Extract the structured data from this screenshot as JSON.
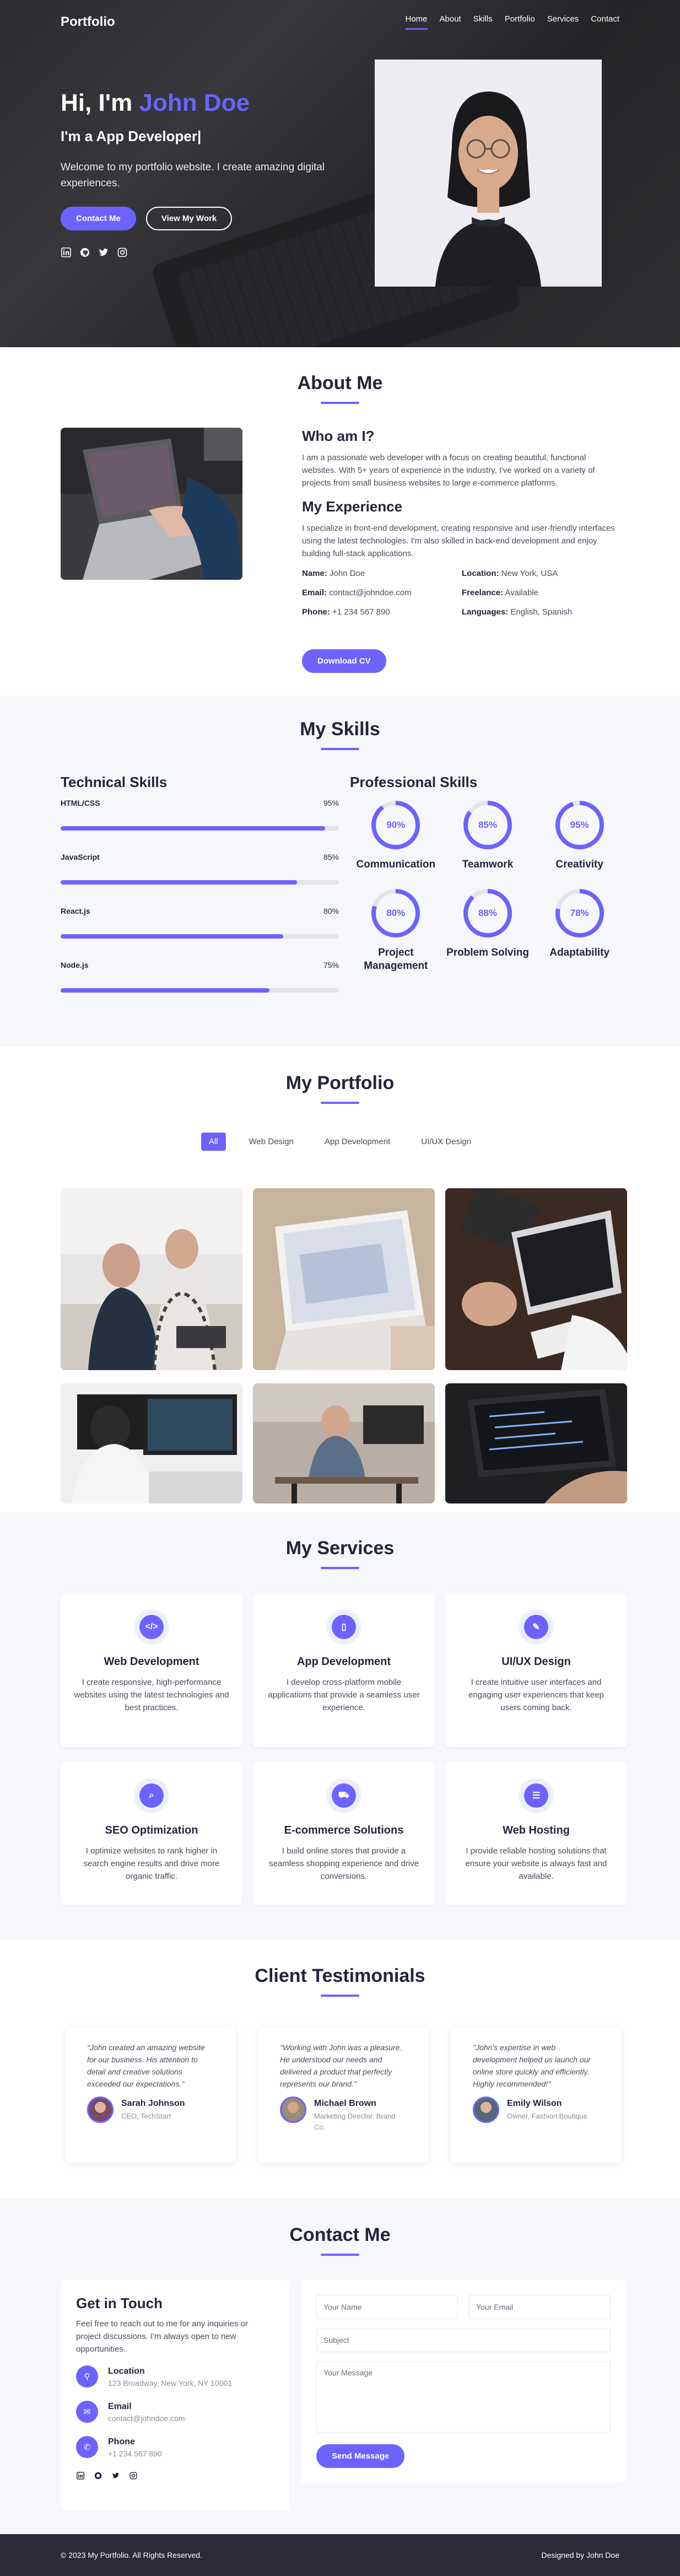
{
  "nav": {
    "logo": "Portfolio",
    "links": [
      "Home",
      "About",
      "Skills",
      "Portfolio",
      "Services",
      "Contact"
    ]
  },
  "hero": {
    "greeting": "Hi, I'm ",
    "name": "John Doe",
    "subtitle": "I'm a App Developer|",
    "description": "Welcome to my portfolio website. I create amazing digital experiences.",
    "btn_contact": "Contact Me",
    "btn_work": "View My Work",
    "socials": [
      "linkedin-icon",
      "github-icon",
      "twitter-icon",
      "instagram-icon"
    ]
  },
  "about": {
    "title": "About Me",
    "who_title": "Who am I?",
    "who_text": "I am a passionate web developer with a focus on creating beautiful, functional websites. With 5+ years of experience in the industry, I've worked on a variety of projects from small business websites to large e-commerce platforms.",
    "exp_title": "My Experience",
    "exp_text": "I specialize in front-end development, creating responsive and user-friendly interfaces using the latest technologies. I'm also skilled in back-end development and enjoy building full-stack applications.",
    "info": [
      {
        "label": "Name:",
        "value": "John Doe"
      },
      {
        "label": "Location:",
        "value": "New York, USA"
      },
      {
        "label": "Email:",
        "value": "contact@johndoe.com"
      },
      {
        "label": "Freelance:",
        "value": "Available"
      },
      {
        "label": "Phone:",
        "value": "+1 234 567 890"
      },
      {
        "label": "Languages:",
        "value": "English, Spanish"
      }
    ],
    "btn": "Download CV"
  },
  "skills": {
    "title": "My Skills",
    "tech_title": "Technical Skills",
    "tech": [
      {
        "name": "HTML/CSS",
        "pct": "95%",
        "value": 95
      },
      {
        "name": "JavaScript",
        "pct": "85%",
        "value": 85
      },
      {
        "name": "React.js",
        "pct": "80%",
        "value": 80
      },
      {
        "name": "Node.js",
        "pct": "75%",
        "value": 75
      }
    ],
    "prof_title": "Professional Skills",
    "prof": [
      {
        "name": "Communication",
        "pct": "90%",
        "value": 90
      },
      {
        "name": "Teamwork",
        "pct": "85%",
        "value": 85
      },
      {
        "name": "Creativity",
        "pct": "95%",
        "value": 95
      },
      {
        "name": "Project Management",
        "pct": "80%",
        "value": 80
      },
      {
        "name": "Problem Solving",
        "pct": "88%",
        "value": 88
      },
      {
        "name": "Adaptability",
        "pct": "78%",
        "value": 78
      }
    ]
  },
  "portfolio": {
    "title": "My Portfolio",
    "filters": [
      "All",
      "Web Design",
      "App Development",
      "UI/UX Design"
    ]
  },
  "services": {
    "title": "My Services",
    "items": [
      {
        "title": "Web Development",
        "desc": "I create responsive, high-performance websites using the latest technologies and best practices.",
        "icon": "code-icon",
        "glyph": "</>"
      },
      {
        "title": "App Development",
        "desc": "I develop cross-platform mobile applications that provide a seamless user experience.",
        "icon": "mobile-icon",
        "glyph": "▯"
      },
      {
        "title": "UI/UX Design",
        "desc": "I create intuitive user interfaces and engaging user experiences that keep users coming back.",
        "icon": "paint-brush-icon",
        "glyph": "✎"
      },
      {
        "title": "SEO Optimization",
        "desc": "I optimize websites to rank higher in search engine results and drive more organic traffic.",
        "icon": "search-icon",
        "glyph": "⌕"
      },
      {
        "title": "E-commerce Solutions",
        "desc": "I build online stores that provide a seamless shopping experience and drive conversions.",
        "icon": "shopping-cart-icon",
        "glyph": "⛟"
      },
      {
        "title": "Web Hosting",
        "desc": "I provide reliable hosting solutions that ensure your website is always fast and available.",
        "icon": "server-icon",
        "glyph": "☰"
      }
    ]
  },
  "testimonials": {
    "title": "Client Testimonials",
    "items": [
      {
        "quote": "\"John created an amazing website for our business. His attention to detail and creative solutions exceeded our expectations.\"",
        "name": "Sarah Johnson",
        "role": "CEO, TechStart"
      },
      {
        "quote": "\"Working with John was a pleasure. He understood our needs and delivered a product that perfectly represents our brand.\"",
        "name": "Michael Brown",
        "role": "Marketing Director, Brand Co."
      },
      {
        "quote": "\"John's expertise in web development helped us launch our online store quickly and efficiently. Highly recommended!\"",
        "name": "Emily Wilson",
        "role": "Owner, Fashion Boutique"
      }
    ]
  },
  "contact": {
    "title": "Contact Me",
    "info_title": "Get in Touch",
    "info_desc": "Feel free to reach out to me for any inquiries or project discussions. I'm always open to new opportunities.",
    "rows": [
      {
        "label": "Location",
        "value": "123 Broadway, New York, NY 10001",
        "icon": "map-marker-icon",
        "glyph": "⚲"
      },
      {
        "label": "Email",
        "value": "contact@johndoe.com",
        "icon": "envelope-icon",
        "glyph": "✉"
      },
      {
        "label": "Phone",
        "value": "+1 234 567 890",
        "icon": "phone-icon",
        "glyph": "✆"
      }
    ],
    "form": {
      "name_ph": "Your Name",
      "email_ph": "Your Email",
      "subject_ph": "Subject",
      "message_ph": "Your Message",
      "btn": "Send Message"
    }
  },
  "footer": {
    "copyright": "© 2023 My Portfolio. All Rights Reserved.",
    "credit": "Designed by John Doe"
  },
  "colors": {
    "accent": "#6c63ff",
    "dark": "#23253a",
    "footer_bg": "#2a2b36"
  }
}
